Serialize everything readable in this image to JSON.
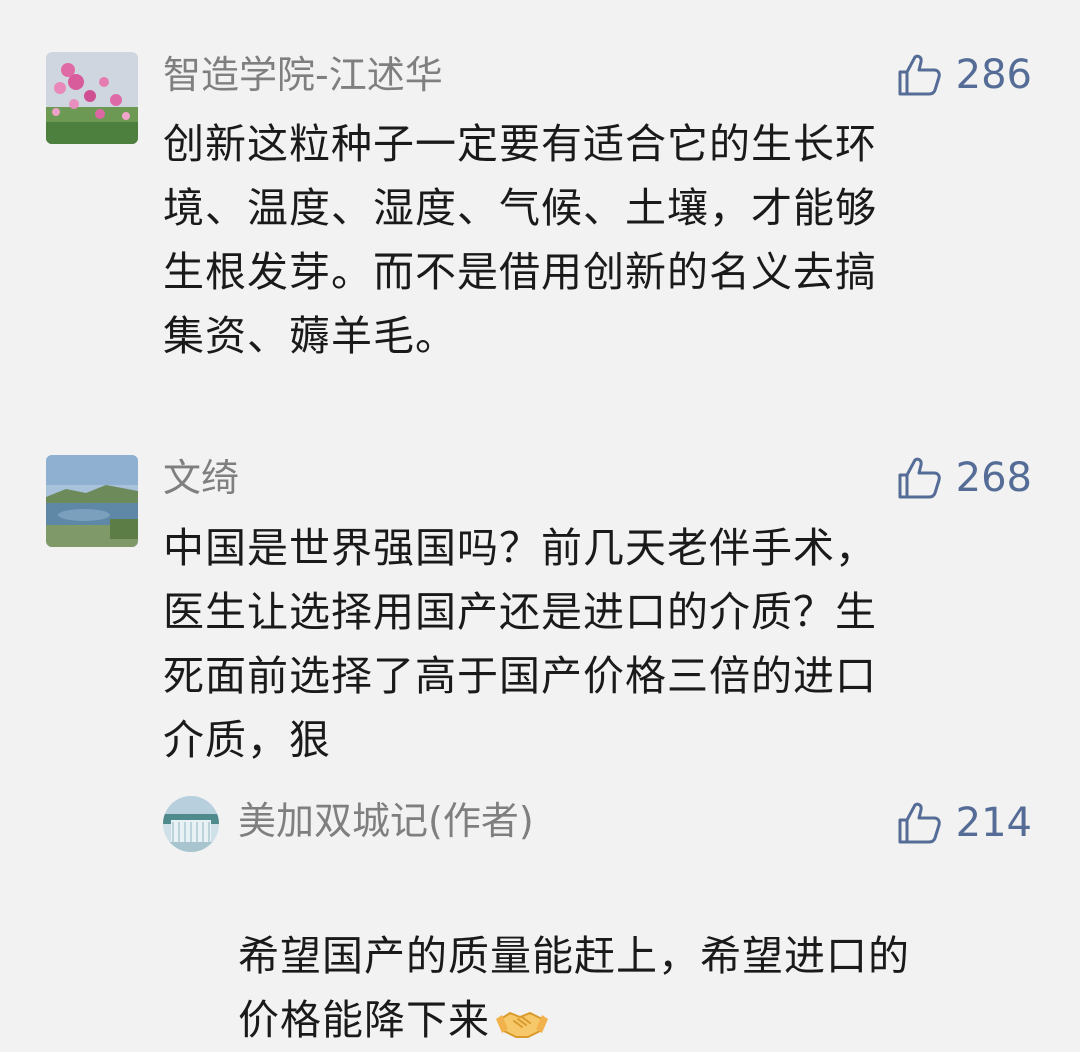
{
  "comments": [
    {
      "username": "智造学院-江述华",
      "likes": "286",
      "text": "创新这粒种子一定要有适合它的生长环\n境、温度、湿度、气候、土壤，才能够\n生根发芽。而不是借用创新的名义去搞\n集资、薅羊毛。",
      "avatar_icon": "flower-field-avatar"
    },
    {
      "username": "文绮",
      "likes": "268",
      "text": "中国是世界强国吗？前几天老伴手术，\n医生让选择用国产还是进口的介质？生\n死面前选择了高于国产价格三倍的进口\n介质，狠",
      "avatar_icon": "lake-landscape-avatar"
    }
  ],
  "reply": {
    "username": "美加双城记(作者)",
    "likes": "214",
    "text": "希望国产的质量能赶上，希望进口的\n价格能降下来",
    "emoji_icon": "handshake-emoji-icon",
    "avatar_icon": "waterfall-avatar"
  },
  "colors": {
    "background": "#f2f2f2",
    "username": "#7f7f7f",
    "likes": "#556c96",
    "text": "#1a1a1a"
  },
  "like_icon": "thumbs-up-icon"
}
